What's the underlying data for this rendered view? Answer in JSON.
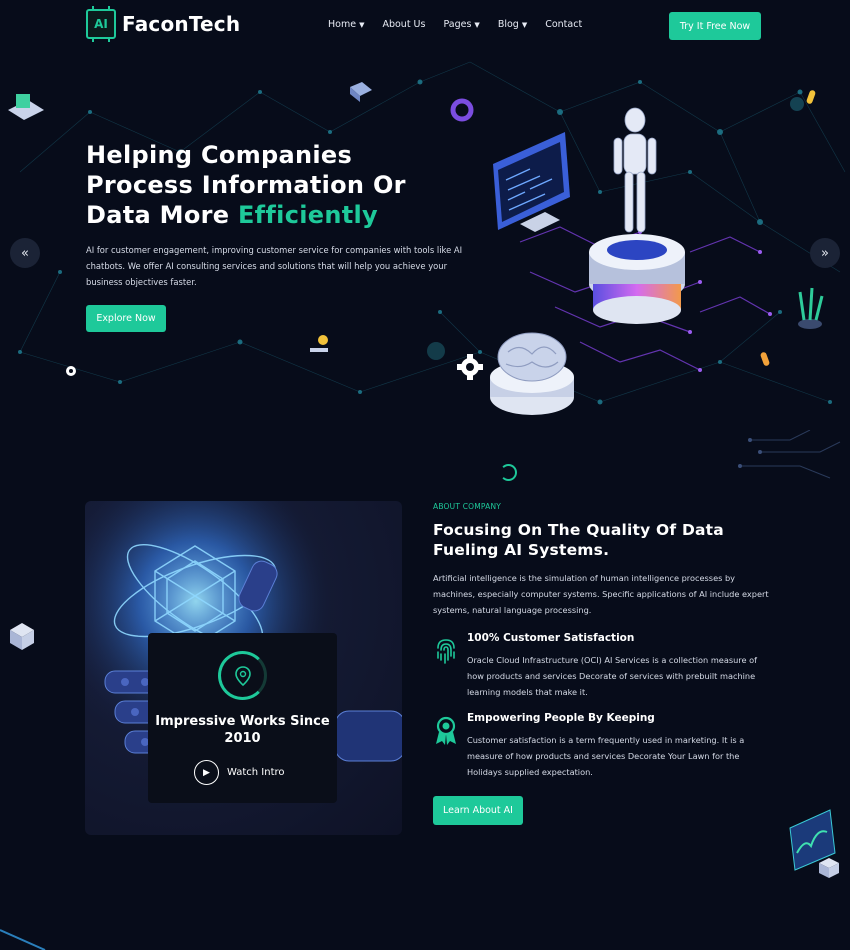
{
  "header": {
    "logo_badge": "AI",
    "logo_text": "FaconTech",
    "nav": [
      {
        "label": "Home",
        "dropdown": true
      },
      {
        "label": "About Us",
        "dropdown": false
      },
      {
        "label": "Pages",
        "dropdown": true
      },
      {
        "label": "Blog",
        "dropdown": true
      },
      {
        "label": "Contact",
        "dropdown": false
      }
    ],
    "cta_label": "Try It Free Now"
  },
  "hero": {
    "title_line1": "Helping Companies",
    "title_line2": "Process Information Or",
    "title_line3_plain": "Data More ",
    "title_line3_accent": "Efficiently",
    "description": "AI for customer engagement, improving customer service for companies with tools like AI chatbots. We offer AI consulting services and solutions that will help you achieve your business objectives faster.",
    "button_label": "Explore Now",
    "prev_arrow": "«",
    "next_arrow": "»"
  },
  "about": {
    "tag": "ABOUT COMPANY",
    "title": "Focusing On The Quality Of Data Fueling AI Systems.",
    "description": "Artificial intelligence is the simulation of human intelligence processes by machines, especially computer systems. Specific applications of AI include expert systems, natural language processing.",
    "card_title": "Impressive Works Since 2010",
    "watch_label": "Watch Intro",
    "features": [
      {
        "icon": "fingerprint-icon",
        "title": "100% Customer Satisfaction",
        "desc": "Oracle Cloud Infrastructure (OCI) AI Services is a collection measure of how products and services Decorate of services with prebuilt machine learning models that make it."
      },
      {
        "icon": "award-badge-icon",
        "title": "Empowering People By Keeping",
        "desc": "Customer satisfaction is a term frequently used in marketing. It is a measure of how products and services Decorate Your Lawn for the Holidays supplied expectation."
      }
    ],
    "button_label": "Learn About AI"
  },
  "colors": {
    "background": "#070c1a",
    "accent": "#1ec99a",
    "text": "#ffffff"
  }
}
